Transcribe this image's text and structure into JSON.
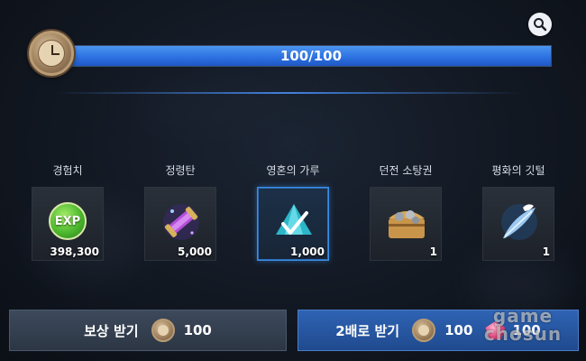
{
  "timer": {
    "value_text": "100/100",
    "current": 100,
    "max": 100,
    "fill_fraction": 1.0
  },
  "search": {
    "icon": "search-icon"
  },
  "items": [
    {
      "label": "경험치",
      "count": "398,300",
      "icon": "exp-orb-icon",
      "selected": false
    },
    {
      "label": "정령탄",
      "count": "5,000",
      "icon": "spirit-bullet-scroll-icon",
      "selected": false
    },
    {
      "label": "영혼의 가루",
      "count": "1,000",
      "icon": "soul-powder-crystal-icon",
      "selected": true
    },
    {
      "label": "던전 소탕권",
      "count": "1",
      "icon": "dungeon-chest-icon",
      "selected": false
    },
    {
      "label": "평화의 깃털",
      "count": "1",
      "icon": "peace-feather-icon",
      "selected": false
    }
  ],
  "exp_badge": "EXP",
  "buttons": {
    "claim": {
      "label": "보상 받기",
      "cost": "100",
      "icon": "clock-coin-icon"
    },
    "double": {
      "label": "2배로 받기",
      "cost": "100",
      "gem_cost": "100",
      "icon": "clock-coin-icon",
      "gem_icon": "pink-gem-icon"
    }
  },
  "watermark": {
    "line1": "game",
    "line2": "chosun"
  },
  "colors": {
    "bar_fill": "#2b6fe0",
    "selected_border": "#3a8ee6",
    "double_button": "#2f63b4",
    "claim_button": "#3d4a5c"
  }
}
